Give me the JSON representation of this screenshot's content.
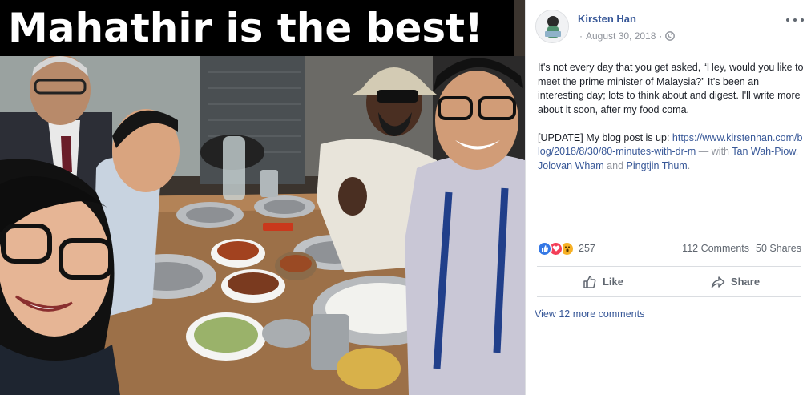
{
  "photo": {
    "caption": "Mahathir is the best!"
  },
  "post": {
    "author": "Kirsten Han",
    "date": "August 30, 2018",
    "meta_separator": "·",
    "privacy_icon": "globe-icon",
    "body_paragraph_1": "It's not every day that you get asked, “Hey, would you like to meet the prime minister of Malaysia?” It's been an interesting day; lots to think about and digest. I'll write more about it soon, after my food coma.",
    "body_update_prefix": "[UPDATE] My blog post is up: ",
    "blog_link": "https://www.kirstenhan.com/blog/2018/8/30/80-minutes-with-dr-m",
    "with_text": " — with ",
    "tag_1": "Tan Wah-Piow",
    "tag_sep_1": ", ",
    "tag_2": "Jolovan Wham",
    "tag_sep_2": " and ",
    "tag_3": "Pingtjin Thum",
    "end_period": "."
  },
  "reactions": {
    "icons": [
      "like-icon",
      "love-icon",
      "wow-icon"
    ],
    "count": "257",
    "comments": "112 Comments",
    "shares": "50 Shares"
  },
  "actions": {
    "like_label": "Like",
    "share_label": "Share"
  },
  "comments": {
    "view_more": "View 12 more comments"
  },
  "colors": {
    "link": "#385898",
    "like_blue": "#3578e5",
    "love_red": "#f33e58",
    "wow_yellow": "#f7b125",
    "muted_text": "#90949c"
  }
}
